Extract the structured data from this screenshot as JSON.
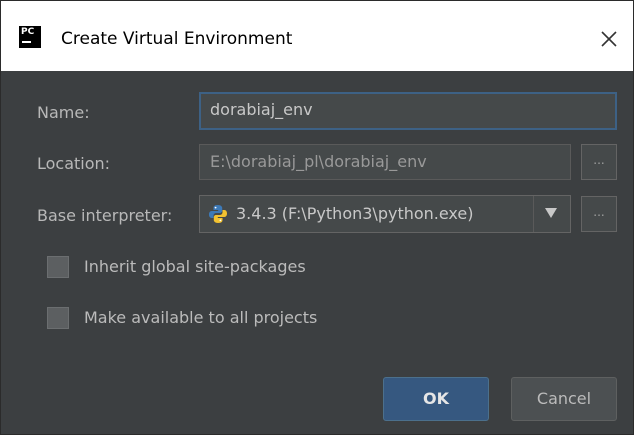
{
  "dialog": {
    "title": "Create Virtual Environment",
    "app_icon": "pycharm-logo-icon",
    "app_icon_text": "PC",
    "close_icon": "close-icon"
  },
  "form": {
    "name_label": "Name:",
    "name_value": "dorabiaj_env",
    "location_label": "Location:",
    "location_value": "E:\\dorabiaj_pl\\dorabiaj_env",
    "location_browse_label": "...",
    "interpreter_label": "Base interpreter:",
    "interpreter_value": "3.4.3 (F:\\Python3\\python.exe)",
    "interpreter_icon": "python-icon",
    "interpreter_browse_label": "...",
    "inherit_label": "Inherit global site-packages",
    "inherit_checked": false,
    "available_label": "Make available to all projects",
    "available_checked": false
  },
  "buttons": {
    "ok_label": "OK",
    "cancel_label": "Cancel"
  },
  "colors": {
    "background": "#3c3f41",
    "accent": "#365880",
    "focus_border": "#3d6185",
    "text": "#bbbbbb"
  }
}
